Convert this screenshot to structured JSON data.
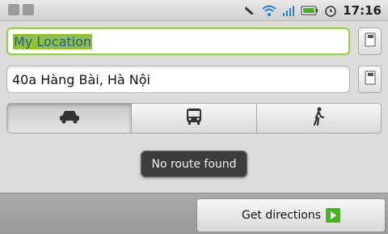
{
  "status_bar": {
    "time": "17:16",
    "icons": [
      "notification-icon",
      "notification-icon",
      "airplane-mode-icon",
      "wifi-icon",
      "signal-icon",
      "battery-icon",
      "alarm-icon"
    ]
  },
  "directions": {
    "start_value": "My Location",
    "end_value": "40a Hàng Bài, Hà Nội"
  },
  "travel_modes": [
    {
      "mode": "driving",
      "icon": "car-icon",
      "selected": true
    },
    {
      "mode": "transit",
      "icon": "bus-icon",
      "selected": false
    },
    {
      "mode": "walking",
      "icon": "walk-icon",
      "selected": false
    }
  ],
  "toast": {
    "message": "No route found"
  },
  "footer": {
    "get_directions_label": "Get directions"
  },
  "colors": {
    "focus_border": "#9ccc4e",
    "selection_highlight": "#8fc23a",
    "go_icon": "#4caf2a"
  }
}
